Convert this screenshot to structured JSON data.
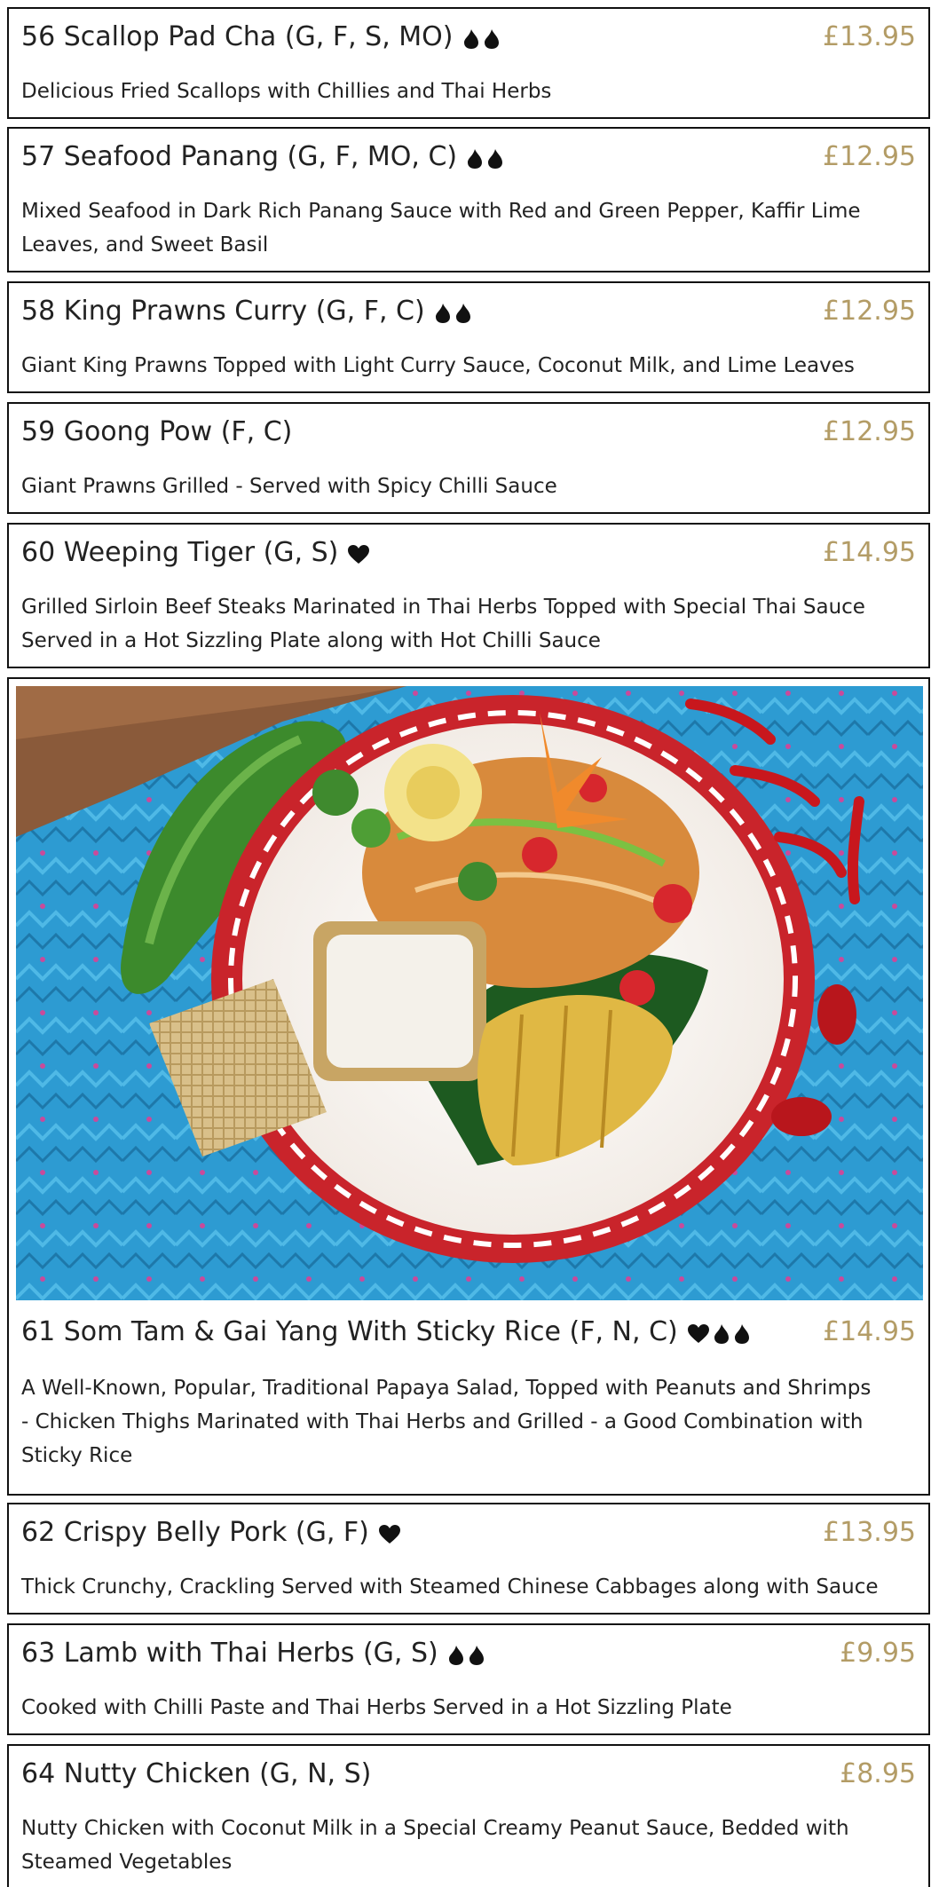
{
  "colors": {
    "price": "#b39c66",
    "border": "#111111",
    "text": "#222222"
  },
  "items": [
    {
      "title": "56 Scallop Pad Cha (G, F, S, MO)",
      "icons": [
        "chilli-icon",
        "chilli-icon"
      ],
      "price": "£13.95",
      "desc": [
        "Delicious Fried Scallops with Chillies and Thai Herbs"
      ]
    },
    {
      "title": "57 Seafood Panang (G, F, MO, C)",
      "icons": [
        "chilli-icon",
        "chilli-icon"
      ],
      "price": "£12.95",
      "desc": [
        "Mixed Seafood in Dark Rich Panang Sauce with Red and Green Pepper, Kaffir Lime",
        "Leaves, and Sweet Basil"
      ]
    },
    {
      "title": "58 King Prawns Curry (G, F, C)",
      "icons": [
        "chilli-icon",
        "chilli-icon"
      ],
      "price": "£12.95",
      "desc": [
        "Giant King Prawns Topped with Light Curry Sauce, Coconut Milk, and Lime Leaves"
      ]
    },
    {
      "title": "59 Goong Pow (F, C)",
      "icons": [],
      "price": "£12.95",
      "desc": [
        "Giant Prawns Grilled - Served with Spicy Chilli Sauce"
      ]
    },
    {
      "title": "60 Weeping Tiger (G, S)",
      "icons": [
        "heart-icon"
      ],
      "price": "£14.95",
      "desc": [
        "Grilled Sirloin Beef Steaks Marinated in Thai Herbs Topped with Special Thai Sauce",
        "Served in a Hot Sizzling Plate along with Hot Chilli Sauce"
      ]
    },
    {
      "title": "61 Som Tam & Gai Yang With Sticky Rice (F, N, C)",
      "icons": [
        "heart-icon",
        "chilli-icon",
        "chilli-icon"
      ],
      "price": "£14.95",
      "desc": [
        "A Well-Known, Popular, Traditional Papaya Salad, Topped with Peanuts and Shrimps",
        "- Chicken Thighs Marinated with Thai Herbs and Grilled - a Good Combination with",
        "Sticky Rice"
      ]
    },
    {
      "title": "62 Crispy Belly Pork (G, F)",
      "icons": [
        "heart-icon"
      ],
      "price": "£13.95",
      "desc": [
        "Thick Crunchy, Crackling Served with Steamed Chinese Cabbages along with Sauce"
      ]
    },
    {
      "title": "63 Lamb with Thai Herbs (G, S)",
      "icons": [
        "chilli-icon",
        "chilli-icon"
      ],
      "price": "£9.95",
      "desc": [
        "Cooked with Chilli Paste and Thai Herbs Served in a Hot Sizzling Plate"
      ]
    },
    {
      "title": "64 Nutty Chicken (G, N, S)",
      "icons": [],
      "price": "£8.95",
      "desc": [
        "Nutty Chicken with Coconut Milk in a Special Creamy Peanut Sauce, Bedded with",
        "Steamed Vegetables"
      ]
    }
  ]
}
